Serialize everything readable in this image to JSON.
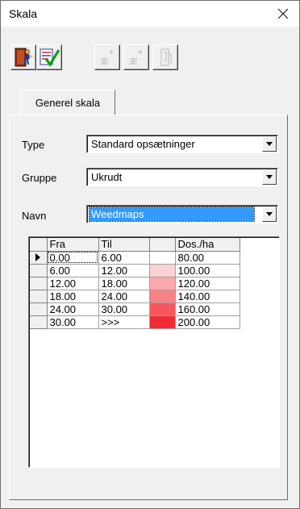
{
  "window": {
    "title": "Skala"
  },
  "toolbar": {
    "buttons": [
      {
        "name": "exit-door-icon",
        "enabled": true
      },
      {
        "name": "accept-checklist-icon",
        "enabled": true
      },
      {
        "name": "table-sparkle-icon",
        "enabled": false
      },
      {
        "name": "table-sparkle-icon-2",
        "enabled": false
      },
      {
        "name": "document-icon",
        "enabled": false
      }
    ]
  },
  "tabs": [
    {
      "label": "Generel skala",
      "active": true
    }
  ],
  "form": {
    "type_label": "Type",
    "type_value": "Standard opsætninger",
    "gruppe_label": "Gruppe",
    "gruppe_value": "Ukrudt",
    "navn_label": "Navn",
    "navn_value": "Weedmaps"
  },
  "grid": {
    "columns": [
      "Fra",
      "Til",
      "",
      "Dos./ha"
    ],
    "rows": [
      {
        "fra": "0.00",
        "til": "6.00",
        "color": "#ffffff",
        "dos": "80.00"
      },
      {
        "fra": "6.00",
        "til": "12.00",
        "color": "#fcd2d4",
        "dos": "100.00"
      },
      {
        "fra": "12.00",
        "til": "18.00",
        "color": "#fba8ab",
        "dos": "120.00"
      },
      {
        "fra": "18.00",
        "til": "24.00",
        "color": "#f98186",
        "dos": "140.00"
      },
      {
        "fra": "24.00",
        "til": "30.00",
        "color": "#f6575e",
        "dos": "160.00"
      },
      {
        "fra": "30.00",
        "til": ">>>",
        "color": "#f22a33",
        "dos": "200.00"
      }
    ],
    "current_row": 0
  },
  "colors": {
    "selection": "#3399ff",
    "face": "#f0f0f0"
  }
}
